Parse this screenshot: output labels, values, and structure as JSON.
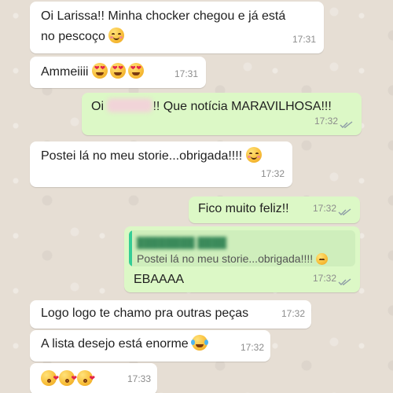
{
  "messages": [
    {
      "dir": "in",
      "text1": "Oi Larissa!! Minha chocker chegou e já está",
      "text2": "no pescoço",
      "time": "17:31",
      "emoji": "smiling-face-with-hearts"
    },
    {
      "dir": "in",
      "text": "Ammeiiii",
      "time": "17:31",
      "emoji": "heart-eyes x3"
    },
    {
      "dir": "out",
      "text_pre": "Oi",
      "text_post": "!! Que notícia MARAVILHOSA!!!",
      "time": "17:32"
    },
    {
      "dir": "in",
      "text": "Postei lá no meu storie...obrigada!!!!",
      "time": "17:32",
      "emoji": "smiling-face"
    },
    {
      "dir": "out",
      "text": "Fico muito feliz!!",
      "time": "17:32"
    },
    {
      "dir": "out",
      "quote_text": "Postei lá no meu storie...obrigada!!!!",
      "text": "EBAAAA",
      "time": "17:32"
    },
    {
      "dir": "in",
      "text": "Logo logo te chamo pra outras peças",
      "time": "17:32"
    },
    {
      "dir": "in",
      "text": "A lista desejo está enorme",
      "time": "17:32",
      "emoji": "face-with-tears-of-joy"
    },
    {
      "dir": "in",
      "text": "",
      "time": "17:33",
      "emoji": "face-blowing-kiss x3"
    }
  ],
  "colors": {
    "incoming": "#ffffff",
    "outgoing": "#dcf8c6",
    "read_ticks": "#8c9ba5",
    "quote_accent": "#35cd96"
  }
}
